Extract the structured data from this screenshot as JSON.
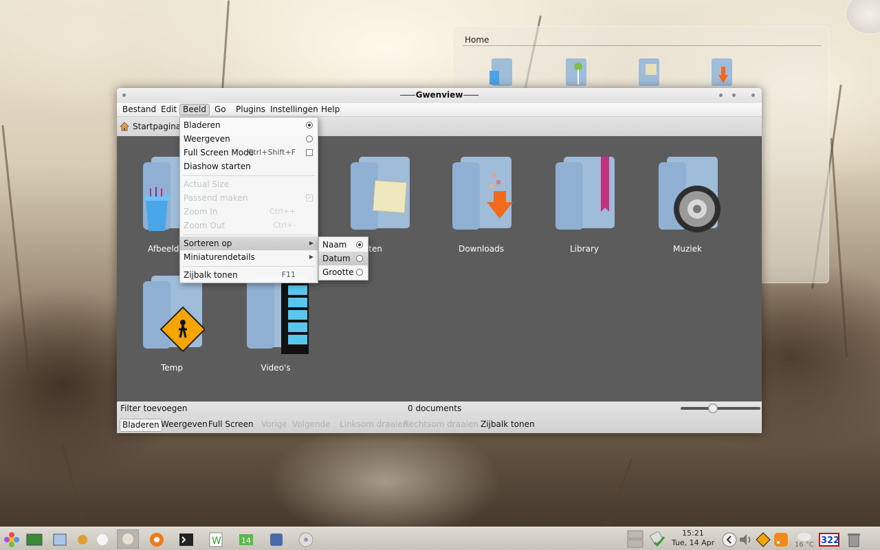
{
  "window": {
    "title": "Gwenview"
  },
  "menubar": [
    "Bestand",
    "Edit",
    "Beeld",
    "Go",
    "Plugins",
    "Instellingen",
    "Help"
  ],
  "location": {
    "crumb": "Startpagina"
  },
  "folders": [
    {
      "label": "Afbeeldingen",
      "visible_label": "Afbeeldi"
    },
    {
      "label": "Documenten",
      "visible_label": "umenten"
    },
    {
      "label": "Downloads"
    },
    {
      "label": "Library"
    },
    {
      "label": "Muziek"
    },
    {
      "label": "Temp"
    },
    {
      "label": "Video's"
    }
  ],
  "beeld_menu": {
    "items": [
      {
        "label": "Bladeren",
        "control": "radio-on"
      },
      {
        "label": "Weergeven",
        "control": "radio"
      },
      {
        "label": "Full Screen Mode",
        "shortcut": "Ctrl+Shift+F",
        "control": "check"
      },
      {
        "label": "Diashow starten"
      },
      {
        "label": "Actual Size",
        "disabled": true
      },
      {
        "label": "Passend maken",
        "disabled": true,
        "control": "check-on"
      },
      {
        "label": "Zoom In",
        "shortcut": "Ctrl++",
        "disabled": true
      },
      {
        "label": "Zoom Out",
        "shortcut": "Ctrl+-",
        "disabled": true
      },
      {
        "label": "Sorteren op",
        "submenu": true,
        "highlight": true
      },
      {
        "label": "Miniaturendetails",
        "submenu": true
      },
      {
        "label": "Zijbalk tonen",
        "shortcut": "F11"
      }
    ]
  },
  "sort_menu": {
    "items": [
      {
        "label": "Naam",
        "control": "radio-on"
      },
      {
        "label": "Datum",
        "control": "radio",
        "highlight": true
      },
      {
        "label": "Grootte",
        "control": "radio"
      }
    ]
  },
  "statusbar": {
    "filter": "Filter toevoegen",
    "count": "0 documents"
  },
  "bottombar": [
    "Bladeren",
    "Weergeven",
    "Full Screen",
    "Vorige",
    "Volgende",
    "Linksom draaien",
    "Rechtsom draaien",
    "Zijbalk tonen"
  ],
  "home_widget": {
    "title": "Home"
  },
  "taskbar": {
    "time": "15:21",
    "date": "Tue, 14 Apr",
    "temperature": "16 °C",
    "badge": "322"
  },
  "colors": {
    "folder_blue": "#9fbcd9",
    "content_bg": "#5c5c5c",
    "menu_highlight": "#c8c8c8"
  }
}
